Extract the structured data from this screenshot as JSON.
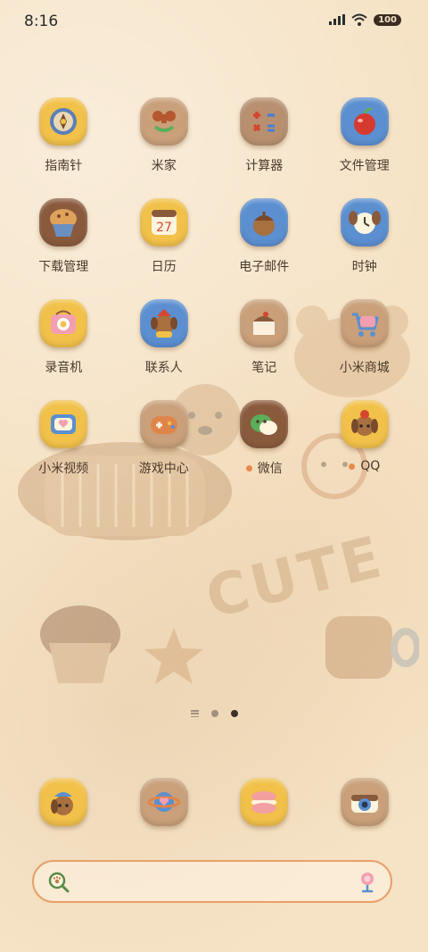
{
  "status_bar": {
    "time": "8:16",
    "battery": "100"
  },
  "apps": [
    {
      "label": "指南针",
      "icon": "compass-icon",
      "color": "#f2c14a"
    },
    {
      "label": "米家",
      "icon": "mi-home-icon",
      "color": "#c9a07a"
    },
    {
      "label": "计算器",
      "icon": "calculator-icon",
      "color": "#b89070"
    },
    {
      "label": "文件管理",
      "icon": "file-manager-icon",
      "color": "#5b8fd0"
    },
    {
      "label": "下载管理",
      "icon": "download-manager-icon",
      "color": "#8a5a3c"
    },
    {
      "label": "日历",
      "icon": "calendar-icon",
      "color": "#f2c14a"
    },
    {
      "label": "电子邮件",
      "icon": "email-icon",
      "color": "#5b8fd0"
    },
    {
      "label": "时钟",
      "icon": "clock-icon",
      "color": "#5b8fd0"
    },
    {
      "label": "录音机",
      "icon": "recorder-icon",
      "color": "#f2c14a"
    },
    {
      "label": "联系人",
      "icon": "contacts-icon",
      "color": "#5b8fd0"
    },
    {
      "label": "笔记",
      "icon": "notes-icon",
      "color": "#c9a07a"
    },
    {
      "label": "小米商城",
      "icon": "mi-store-icon",
      "color": "#c9a07a"
    },
    {
      "label": "小米视频",
      "icon": "mi-video-icon",
      "color": "#f2c14a"
    },
    {
      "label": "游戏中心",
      "icon": "game-center-icon",
      "color": "#c9a07a"
    },
    {
      "label": "微信",
      "icon": "wechat-icon",
      "color": "#8a5a3c",
      "new": true
    },
    {
      "label": "QQ",
      "icon": "qq-icon",
      "color": "#f2c14a",
      "new": true
    }
  ],
  "dock": [
    {
      "icon": "phone-icon",
      "color": "#f2c14a"
    },
    {
      "icon": "browser-icon",
      "color": "#c9a07a"
    },
    {
      "icon": "messages-icon",
      "color": "#f2c14a"
    },
    {
      "icon": "camera-icon",
      "color": "#c9a07a"
    }
  ],
  "search": {
    "placeholder": ""
  },
  "pager": {
    "pages": 2,
    "current": 2
  },
  "wallpaper_text": "CUTE",
  "colors": {
    "background": "#f6e3c6",
    "accent": "#e98a4c",
    "text": "#4b3a2c"
  }
}
